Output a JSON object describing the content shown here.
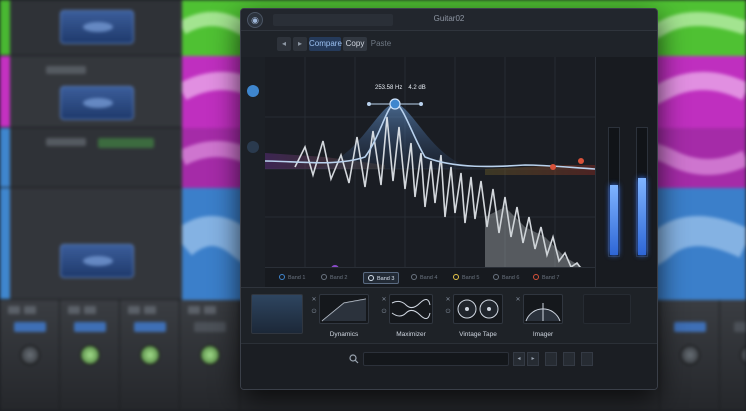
{
  "window": {
    "title": "Guitar02"
  },
  "toolbar": {
    "undo": "◂",
    "redo": "▸",
    "compare": "Compare",
    "copy": "Copy",
    "paste": "Paste"
  },
  "eq_readout": {
    "freq": "253.58 Hz",
    "gain": "4.2 dB"
  },
  "bands": [
    {
      "label": "Band 1",
      "color": "blue"
    },
    {
      "label": "Band 2",
      "color": "grey"
    },
    {
      "label": "Band 3",
      "color": "grey",
      "active": true
    },
    {
      "label": "Band 4",
      "color": "grey"
    },
    {
      "label": "Band 5",
      "color": "yellow"
    },
    {
      "label": "Band 6",
      "color": "grey"
    },
    {
      "label": "Band 7",
      "color": "red"
    }
  ],
  "modules": [
    {
      "label": ""
    },
    {
      "label": "Dynamics"
    },
    {
      "label": "Maximizer"
    },
    {
      "label": "Vintage Tape"
    },
    {
      "label": "Imager"
    }
  ],
  "meters": {
    "left_level": 0.55,
    "right_level": 0.6
  },
  "colors": {
    "accent": "#3f86ce",
    "curve": "#b9d2ee",
    "background": "#1b1e24"
  },
  "icons": {
    "search": "search-icon",
    "logo": "plugin-logo-icon",
    "power": "power-icon"
  }
}
